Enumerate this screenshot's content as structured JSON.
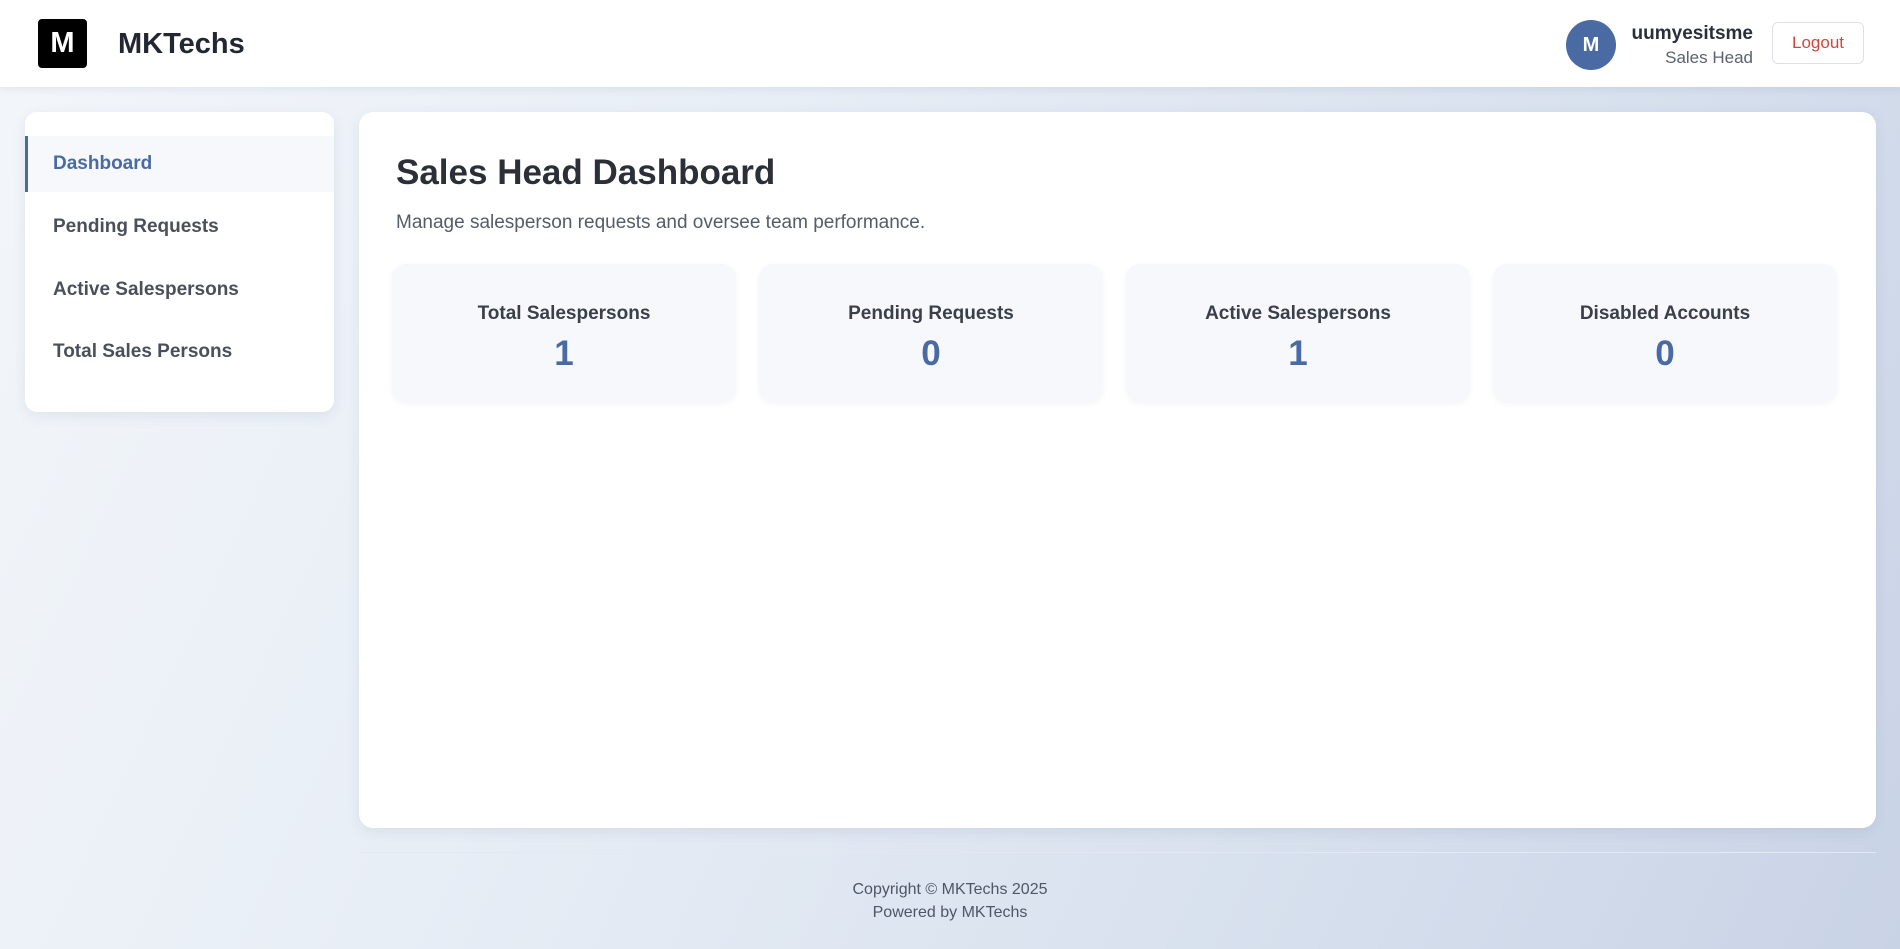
{
  "header": {
    "logo_letter": "M",
    "brand": "MKTechs",
    "avatar_letter": "M",
    "user_name": "uumyesitsme",
    "user_role": "Sales Head",
    "logout_label": "Logout"
  },
  "sidebar": {
    "items": [
      {
        "label": "Dashboard",
        "active": true
      },
      {
        "label": "Pending Requests",
        "active": false
      },
      {
        "label": "Active Salespersons",
        "active": false
      },
      {
        "label": "Total Sales Persons",
        "active": false
      }
    ]
  },
  "main": {
    "title": "Sales Head Dashboard",
    "subtitle": "Manage salesperson requests and oversee team performance.",
    "stats": [
      {
        "label": "Total Salespersons",
        "value": "1"
      },
      {
        "label": "Pending Requests",
        "value": "0"
      },
      {
        "label": "Active Salespersons",
        "value": "1"
      },
      {
        "label": "Disabled Accounts",
        "value": "0"
      }
    ]
  },
  "footer": {
    "copyright": "Copyright © MKTechs 2025",
    "powered": "Powered by MKTechs"
  },
  "colors": {
    "accent": "#4a6aa3",
    "logout_text": "#d0463a"
  }
}
